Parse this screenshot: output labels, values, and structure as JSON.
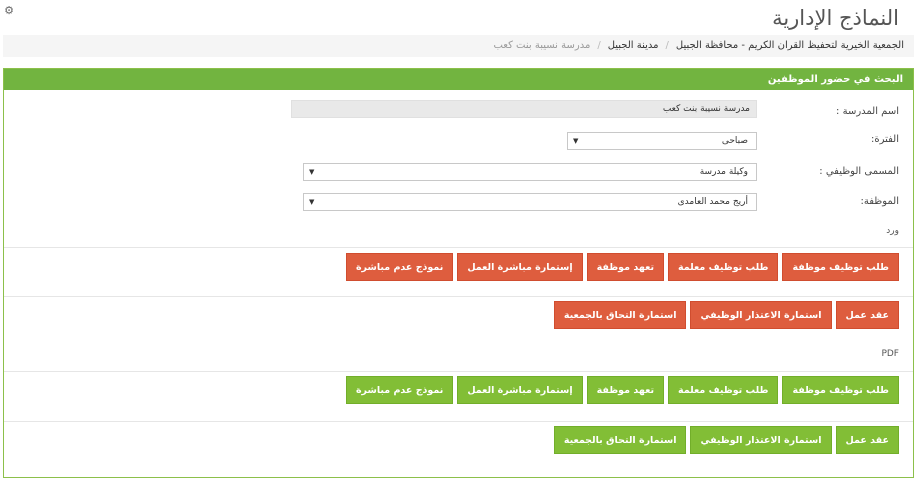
{
  "header": {
    "settings_icon": "⚙",
    "title": "النماذج الإدارية"
  },
  "breadcrumb": [
    "الجمعية الخيرية لتحفيظ القران الكريم - محافظة الجبيل",
    "مدينة الجبيل",
    "مدرسة نسيبة بنت كعب"
  ],
  "panel": {
    "title": "البحث في حضور الموظفين"
  },
  "form": {
    "school": {
      "label": "اسم المدرسة :",
      "value": "مدرسة نسيبة بنت كعب"
    },
    "period": {
      "label": "الفترة:",
      "value": "صباحى"
    },
    "job_title": {
      "label": "المسمى الوظيفي :",
      "value": "وكيلة مدرسة"
    },
    "employee": {
      "label": "الموظفة:",
      "value": "أريج محمد العامدى"
    }
  },
  "sections": {
    "word": {
      "label": "ورد",
      "row1": [
        "طلب توظيف موظفة",
        "طلب توظيف معلمة",
        "تعهد موظفة",
        "إستمارة مباشرة العمل",
        "نموذج عدم مباشرة"
      ],
      "row2": [
        "عقد عمل",
        "استمارة الاعتذار الوظيفي",
        "استمارة التحاق بالجمعية"
      ]
    },
    "pdf": {
      "label": "PDF",
      "row1": [
        "طلب توظيف موظفة",
        "طلب توظيف معلمة",
        "تعهد موظفة",
        "إستمارة مباشرة العمل",
        "نموذج عدم مباشرة"
      ],
      "row2": [
        "عقد عمل",
        "استمارة الاعتذار الوظيفي",
        "استمارة التحاق بالجمعية"
      ]
    }
  },
  "colors": {
    "panel_header": "#72b440",
    "word_button": "#de5d3e",
    "pdf_button": "#82be36"
  }
}
